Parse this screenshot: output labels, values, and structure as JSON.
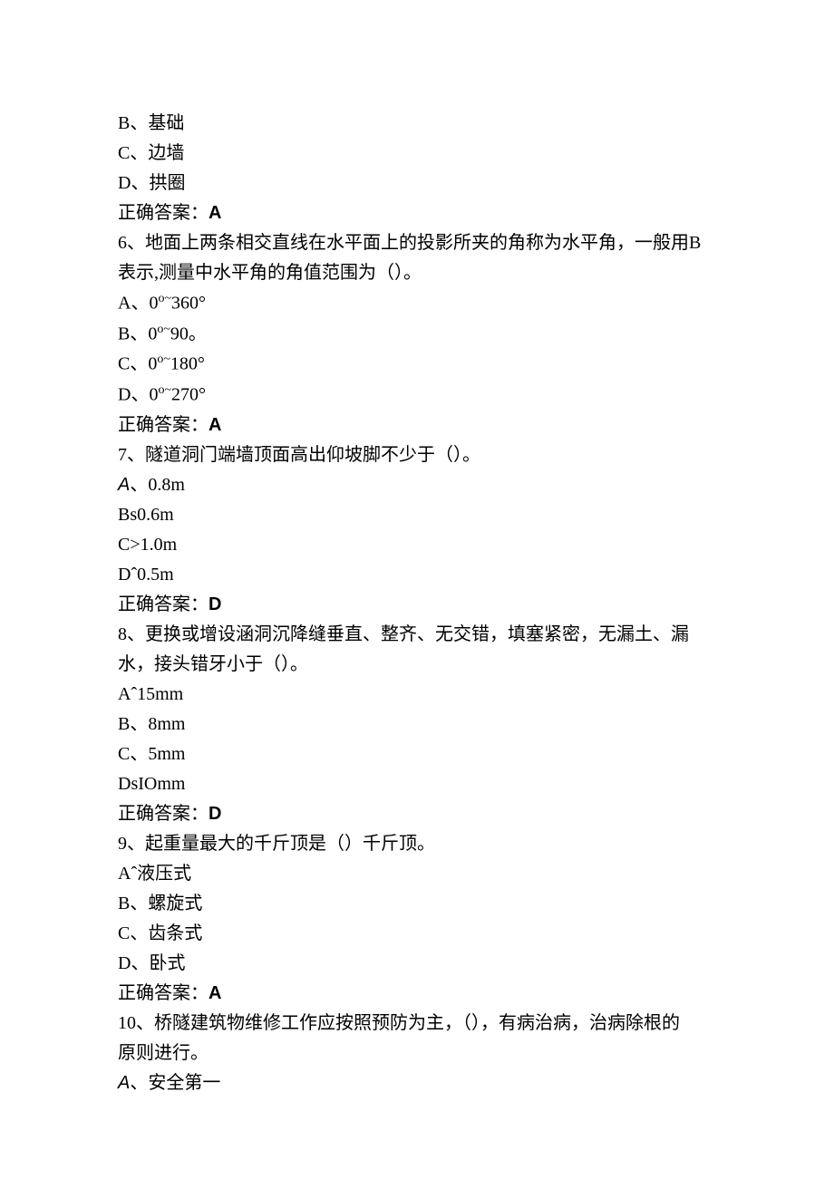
{
  "q5_options": {
    "b": "B、基础",
    "c": "C、边墙",
    "d": "D、拱圈"
  },
  "q5_answer_label": "正确答案：",
  "q5_answer": "A",
  "q6": {
    "stem1": "6、地面上两条相交直线在水平面上的投影所夹的角称为水平角，一般用B",
    "stem2": "表示,测量中水平角的角值范围为（）。",
    "a_pre": "A、0",
    "a_sup": "o~",
    "a_post": "360°",
    "b_pre": "B、0",
    "b_sup": "o~",
    "b_post": "90。",
    "c_pre": "C、0",
    "c_sup": "o~",
    "c_post": "180°",
    "d_pre": "D、0",
    "d_sup": "o~",
    "d_post": "270°"
  },
  "q6_answer_label": "正确答案：",
  "q6_answer": "A",
  "q7": {
    "stem": "7、隧道洞门端墙顶面高出仰坡脚不少于（）。",
    "a_prefix": "A",
    "a_rest": "、0.8m",
    "b": "Bs0.6m",
    "c": "C>1.0m",
    "d": "Dˆ0.5m"
  },
  "q7_answer_label": "正确答案：",
  "q7_answer": "D",
  "q8": {
    "stem1": "8、更换或增设涵洞沉降缝垂直、整齐、无交错，填塞紧密，无漏土、漏",
    "stem2": "水，接头错牙小于（）。",
    "a": "Aˆ15mm",
    "b": "B、8mm",
    "c": "C、5mm",
    "d": "DsIOmm"
  },
  "q8_answer_label": "正确答案：",
  "q8_answer": "D",
  "q9": {
    "stem": "9、起重量最大的千斤顶是（）千斤顶。",
    "a": "Aˆ液压式",
    "b": "B、螺旋式",
    "c": "C、齿条式",
    "d": "D、卧式"
  },
  "q9_answer_label": "正确答案：",
  "q9_answer": "A",
  "q10": {
    "stem1": "10、桥隧建筑物维修工作应按照预防为主，（），有病治病，治病除根的",
    "stem2": "原则进行。",
    "a_prefix": "A",
    "a_rest": "、安全第一"
  }
}
